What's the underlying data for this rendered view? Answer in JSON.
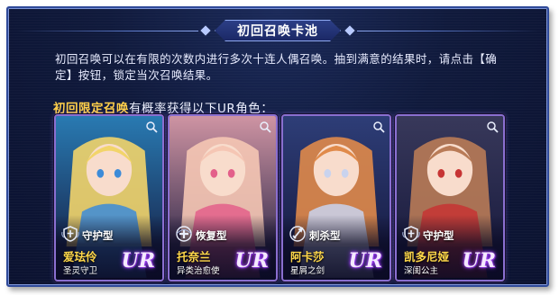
{
  "header": {
    "title": "初回召唤卡池"
  },
  "description": {
    "line1": "初回召唤可以在有限的次数内进行多次十连人偶召唤。抽到满意的结果时，请点击【确",
    "line2": "定】按钮，锁定当次召唤结果。"
  },
  "subtitle": {
    "highlight": "初回限定召唤",
    "rest": "有概率获得以下UR角色："
  },
  "cards": [
    {
      "role": "守护型",
      "name": "爱珐伶",
      "title": "圣灵守卫",
      "rarity": "UR",
      "palette": {
        "bg": "#2a7fb8",
        "hair": "#f2d46a",
        "accent": "#3c8bd8"
      },
      "role_icon": "shield-icon"
    },
    {
      "role": "恢复型",
      "name": "托奈兰",
      "title": "异类治愈使",
      "rarity": "UR",
      "palette": {
        "bg": "#d89aa8",
        "hair": "#f5c6b4",
        "accent": "#e35f8a"
      },
      "role_icon": "heal-icon"
    },
    {
      "role": "刺杀型",
      "name": "阿卡莎",
      "title": "星屑之剑",
      "rarity": "UR",
      "palette": {
        "bg": "#2f3f7a",
        "hair": "#e08a4a",
        "accent": "#c9d3ee"
      },
      "role_icon": "dagger-icon"
    },
    {
      "role": "守护型",
      "name": "凯多尼娅",
      "title": "深闺公主",
      "rarity": "UR",
      "palette": {
        "bg": "#3a3a5c",
        "hair": "#b97b57",
        "accent": "#c73434"
      },
      "role_icon": "shield-icon"
    }
  ],
  "icons": {
    "zoom": "magnifier-icon"
  }
}
